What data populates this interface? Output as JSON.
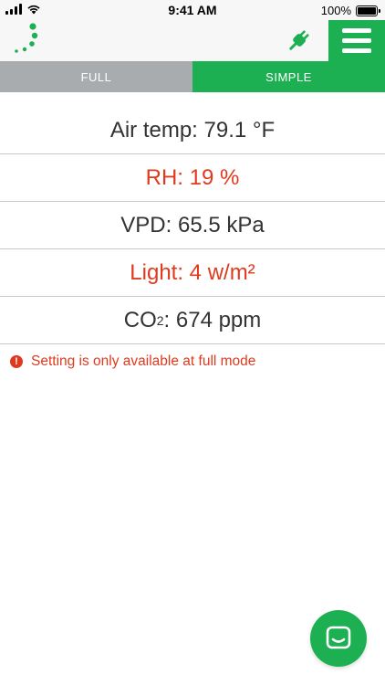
{
  "status_bar": {
    "time": "9:41 AM",
    "battery": "100%"
  },
  "header": {
    "logo_icon": "loading-dots-logo",
    "connection_icon": "plug-icon",
    "menu_icon": "hamburger-menu-icon"
  },
  "tabs": [
    {
      "label": "FULL",
      "active": false
    },
    {
      "label": "SIMPLE",
      "active": true
    }
  ],
  "readings": {
    "air_temp": "Air temp: 79.1 °F",
    "rh": "RH: 19 %",
    "vpd": "VPD: 65.5 kPa",
    "light": "Light: 4 w/m²",
    "co2_prefix": "CO",
    "co2_sub": "2",
    "co2_value": ": 674 ppm"
  },
  "notice": {
    "icon": "!",
    "text": "Setting is only available at full mode"
  },
  "colors": {
    "brand_green": "#1db053",
    "warning_red": "#e03a1e",
    "inactive_gray": "#a9acaf"
  }
}
